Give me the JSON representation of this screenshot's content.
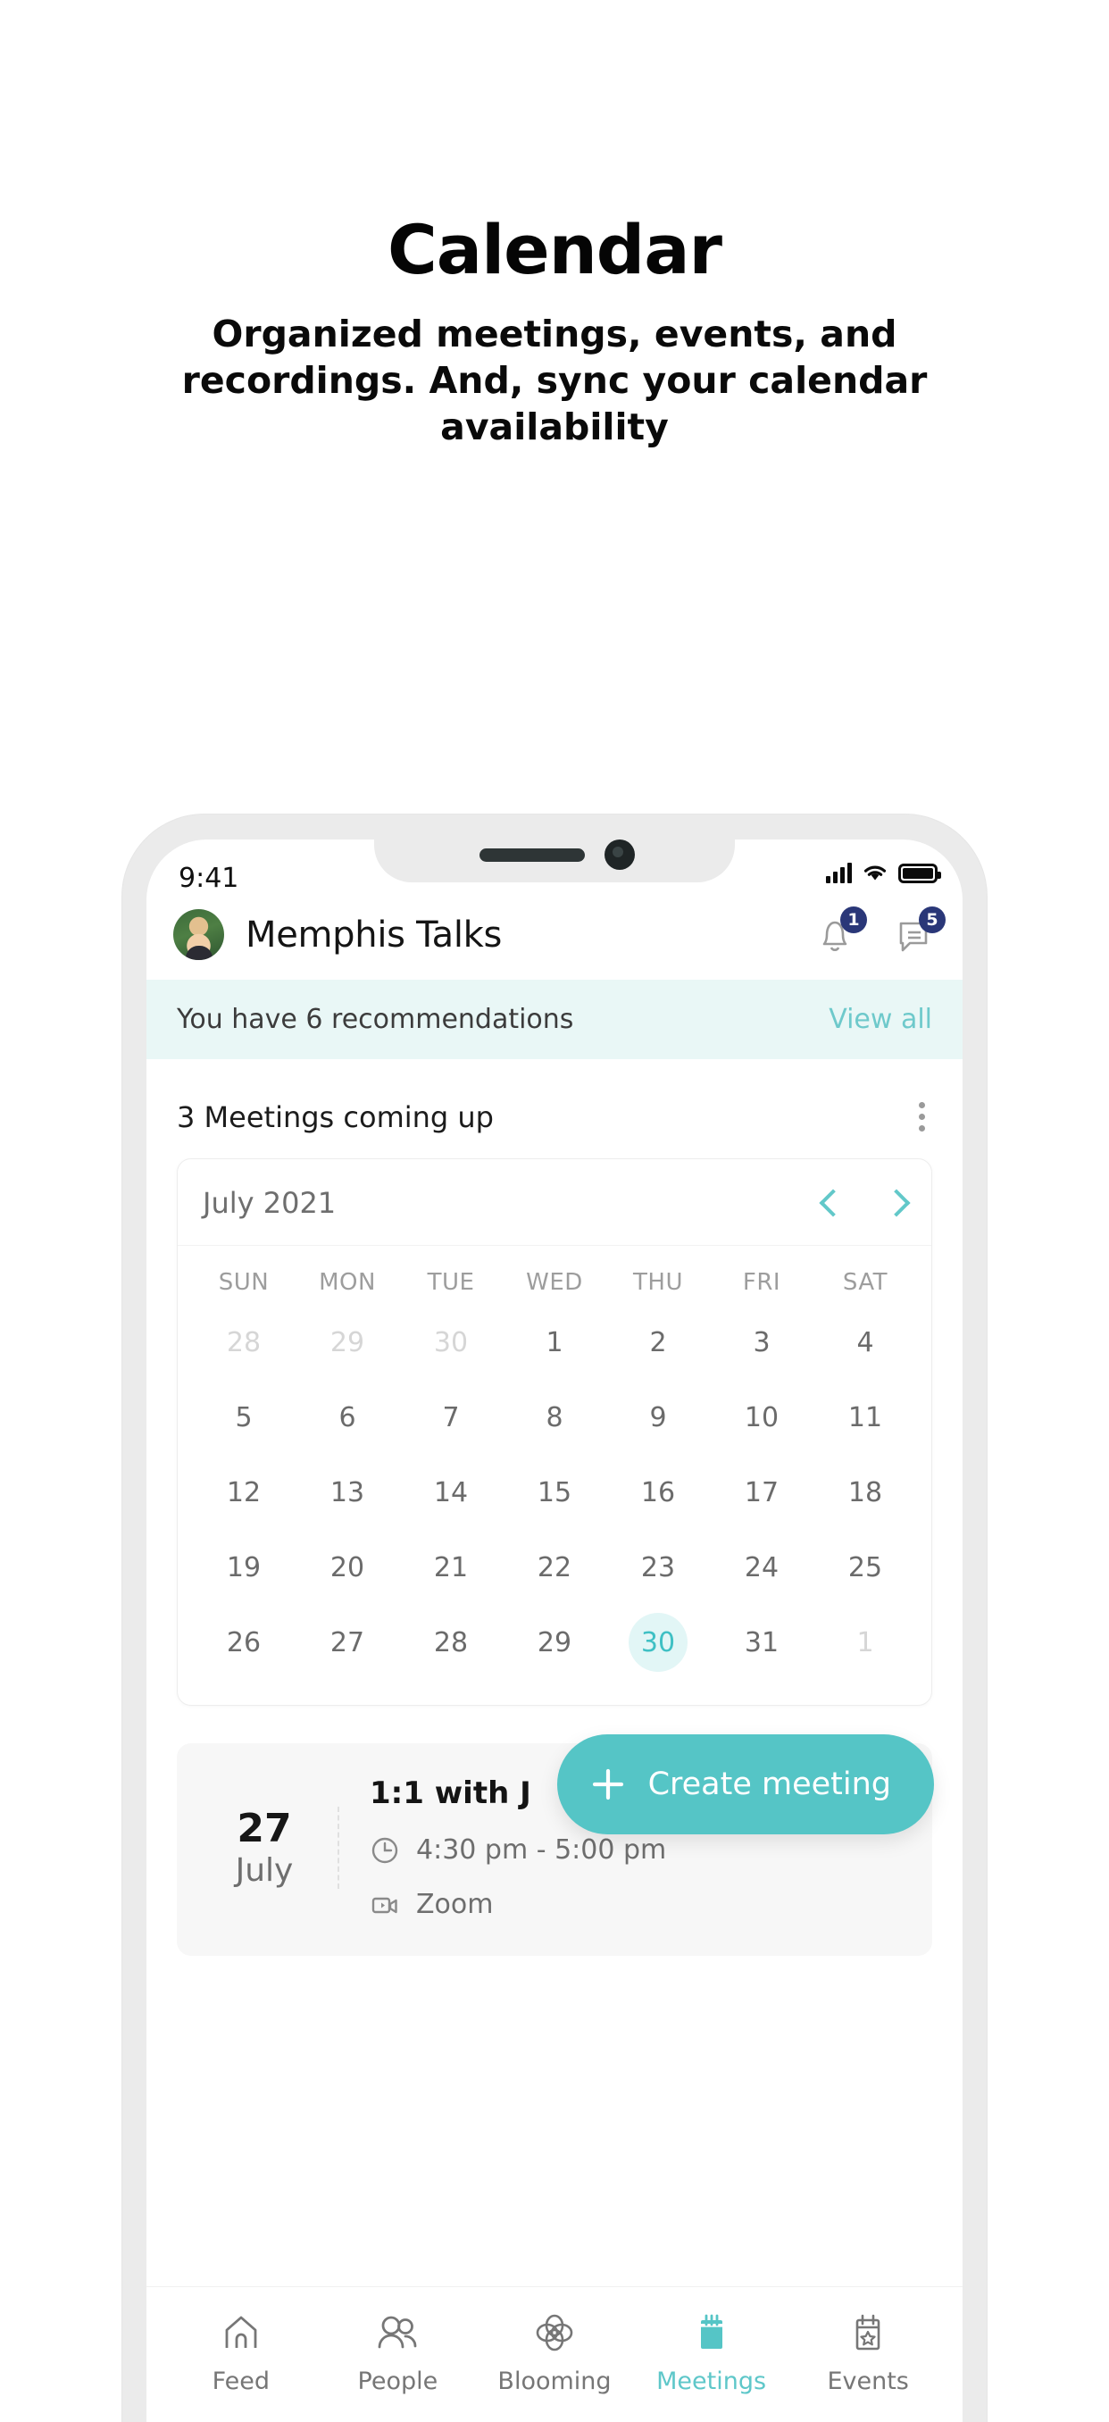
{
  "hero": {
    "title": "Calendar",
    "subtitle": "Organized meetings, events, and recordings. And, sync your calendar availability"
  },
  "colors": {
    "accent_teal": "#55C5C6",
    "accent_teal_text": "#5EC7C9",
    "banner_bg": "#E9F7F6",
    "badge_navy": "#2A3778",
    "today_chip": "#E2F6F6",
    "phone_frame": "#EBEBEB",
    "card_gray": "#F7F7F7"
  },
  "status_bar": {
    "time": "9:41",
    "signal_icon": "cellular-signal-icon",
    "wifi_icon": "wifi-icon",
    "battery_icon": "battery-full-icon"
  },
  "app_bar": {
    "avatar": "user-avatar",
    "title": "Memphis Talks",
    "notifications": {
      "icon": "bell-icon",
      "badge": "1"
    },
    "messages": {
      "icon": "chat-icon",
      "badge": "5"
    }
  },
  "recommendation_banner": {
    "text": "You have 6 recommendations",
    "link": "View all"
  },
  "meetings_section": {
    "title": "3 Meetings coming up",
    "overflow_icon": "kebab-menu-icon"
  },
  "calendar": {
    "month_label": "July 2021",
    "prev_icon": "chevron-left-icon",
    "next_icon": "chevron-right-icon",
    "weekdays": [
      "SUN",
      "MON",
      "TUE",
      "WED",
      "THU",
      "FRI",
      "SAT"
    ],
    "weeks": [
      [
        {
          "d": "28",
          "state": "muted"
        },
        {
          "d": "29",
          "state": "muted"
        },
        {
          "d": "30",
          "state": "muted"
        },
        {
          "d": "1",
          "state": "normal"
        },
        {
          "d": "2",
          "state": "normal"
        },
        {
          "d": "3",
          "state": "normal"
        },
        {
          "d": "4",
          "state": "normal"
        }
      ],
      [
        {
          "d": "5",
          "state": "normal"
        },
        {
          "d": "6",
          "state": "normal"
        },
        {
          "d": "7",
          "state": "normal"
        },
        {
          "d": "8",
          "state": "normal"
        },
        {
          "d": "9",
          "state": "normal"
        },
        {
          "d": "10",
          "state": "normal"
        },
        {
          "d": "11",
          "state": "normal"
        }
      ],
      [
        {
          "d": "12",
          "state": "normal"
        },
        {
          "d": "13",
          "state": "normal"
        },
        {
          "d": "14",
          "state": "normal"
        },
        {
          "d": "15",
          "state": "normal"
        },
        {
          "d": "16",
          "state": "normal"
        },
        {
          "d": "17",
          "state": "normal"
        },
        {
          "d": "18",
          "state": "normal"
        }
      ],
      [
        {
          "d": "19",
          "state": "normal"
        },
        {
          "d": "20",
          "state": "normal"
        },
        {
          "d": "21",
          "state": "normal"
        },
        {
          "d": "22",
          "state": "normal"
        },
        {
          "d": "23",
          "state": "normal"
        },
        {
          "d": "24",
          "state": "normal"
        },
        {
          "d": "25",
          "state": "normal"
        }
      ],
      [
        {
          "d": "26",
          "state": "normal"
        },
        {
          "d": "27",
          "state": "normal"
        },
        {
          "d": "28",
          "state": "normal"
        },
        {
          "d": "29",
          "state": "normal"
        },
        {
          "d": "30",
          "state": "today"
        },
        {
          "d": "31",
          "state": "normal"
        },
        {
          "d": "1",
          "state": "muted"
        }
      ]
    ]
  },
  "meeting_card": {
    "date_number": "27",
    "date_month": "July",
    "title": "1:1 with J",
    "time_icon": "clock-icon",
    "time": "4:30 pm - 5:00 pm",
    "platform_icon": "video-camera-icon",
    "platform": "Zoom"
  },
  "fab": {
    "icon": "plus-icon",
    "label": "Create meeting"
  },
  "tab_bar": {
    "items": [
      {
        "label": "Feed",
        "icon": "home-icon",
        "active": false
      },
      {
        "label": "People",
        "icon": "people-icon",
        "active": false
      },
      {
        "label": "Blooming",
        "icon": "flower-icon",
        "active": false
      },
      {
        "label": "Meetings",
        "icon": "calendar-filled-icon",
        "active": true
      },
      {
        "label": "Events",
        "icon": "calendar-star-icon",
        "active": false
      }
    ]
  }
}
